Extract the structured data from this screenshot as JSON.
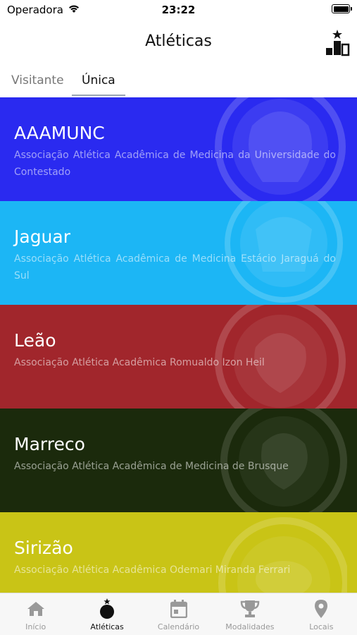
{
  "status": {
    "carrier": "Operadora",
    "time": "23:22"
  },
  "header": {
    "title": "Atléticas",
    "ranking_icon": "podium-star-icon"
  },
  "tabs": [
    {
      "label": "Visitante",
      "active": false
    },
    {
      "label": "Única",
      "active": true
    }
  ],
  "cards": [
    {
      "name": "AAAMUNC",
      "description": "Associação Atlética Acadêmica de Medicina da Universidade do Contestado",
      "color": "#2a2af0"
    },
    {
      "name": "Jaguar",
      "description": "Associação Atlética Acadêmica de Medicina Estácio Jaraguá do Sul",
      "color": "#1cb6f5"
    },
    {
      "name": "Leão",
      "description": "Associação Atlética Acadêmica Romualdo Izon Heil",
      "color": "#a1262c"
    },
    {
      "name": "Marreco",
      "description": "Associação Atlética Acadêmica de Medicina de Brusque",
      "color": "#1b2a0c"
    },
    {
      "name": "Sirizão",
      "description": "Associação Atlética Acadêmica Odemari Miranda Ferrari",
      "color": "#c9c416"
    }
  ],
  "tabbar": [
    {
      "label": "Início",
      "icon": "home-icon",
      "active": false
    },
    {
      "label": "Atléticas",
      "icon": "bomb-icon",
      "active": true
    },
    {
      "label": "Calendário",
      "icon": "calendar-icon",
      "active": false
    },
    {
      "label": "Modalidades",
      "icon": "trophy-icon",
      "active": false
    },
    {
      "label": "Locais",
      "icon": "map-pin-icon",
      "active": false
    }
  ]
}
